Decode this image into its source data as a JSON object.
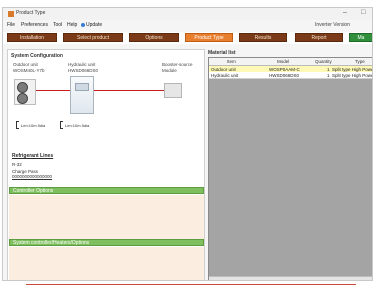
{
  "window": {
    "title": "Product Type",
    "minimize": "–",
    "maximize": "□"
  },
  "menu": {
    "items": [
      "File",
      "Preferences",
      "Tool",
      "Help"
    ],
    "update_label": "Update",
    "right_label": "Inverter Version"
  },
  "tabs": [
    {
      "label": "Installation"
    },
    {
      "label": "Select product"
    },
    {
      "label": "Options"
    },
    {
      "label": "Product Type"
    },
    {
      "label": "Results"
    },
    {
      "label": "Report"
    },
    {
      "label": "Ma"
    }
  ],
  "system_configuration": {
    "title": "System Configuration",
    "outdoor_unit_label": "Outdoor unit",
    "outdoor_unit_model": "WOSM40L-Y7b",
    "hydraulic_unit_label": "Hydraulic unit",
    "hydraulic_unit_model": "HWSD066DS0",
    "booster_module_label": "Booster-source",
    "booster_module_value": "Module",
    "pipe_label_1": "Len:10m 5dia",
    "pipe_label_2": "Len:10m 5dia"
  },
  "refrigerant": {
    "title": "Refrigerant Lines",
    "value": "R-32",
    "charge_label": "Charge Pass",
    "charge_value": "0000000000000000"
  },
  "controller_options_label": "Controller Options",
  "system_controller_options_label": "System controller/Heaters/Options",
  "material_list": {
    "title": "Material list",
    "columns": [
      "Item",
      "Model",
      "Quantity",
      "Type"
    ],
    "rows": [
      {
        "item": "Outdoor unit",
        "model": "WOSP0AAM-C",
        "quantity": "1",
        "type": "Split type High Power / Co",
        "selected": true
      },
      {
        "item": "Hydraulic unit",
        "model": "HWSD066DS0",
        "quantity": "1",
        "type": "Split type High Power / He",
        "selected": false
      }
    ]
  },
  "colors": {
    "tab": "#7b3a17",
    "tab_active": "#e77f2e",
    "green_bar": "#7fbf5f",
    "grid_background": "#a4a4a4",
    "selected_row": "#fff9b8",
    "pipe": "#cc1f1f"
  }
}
